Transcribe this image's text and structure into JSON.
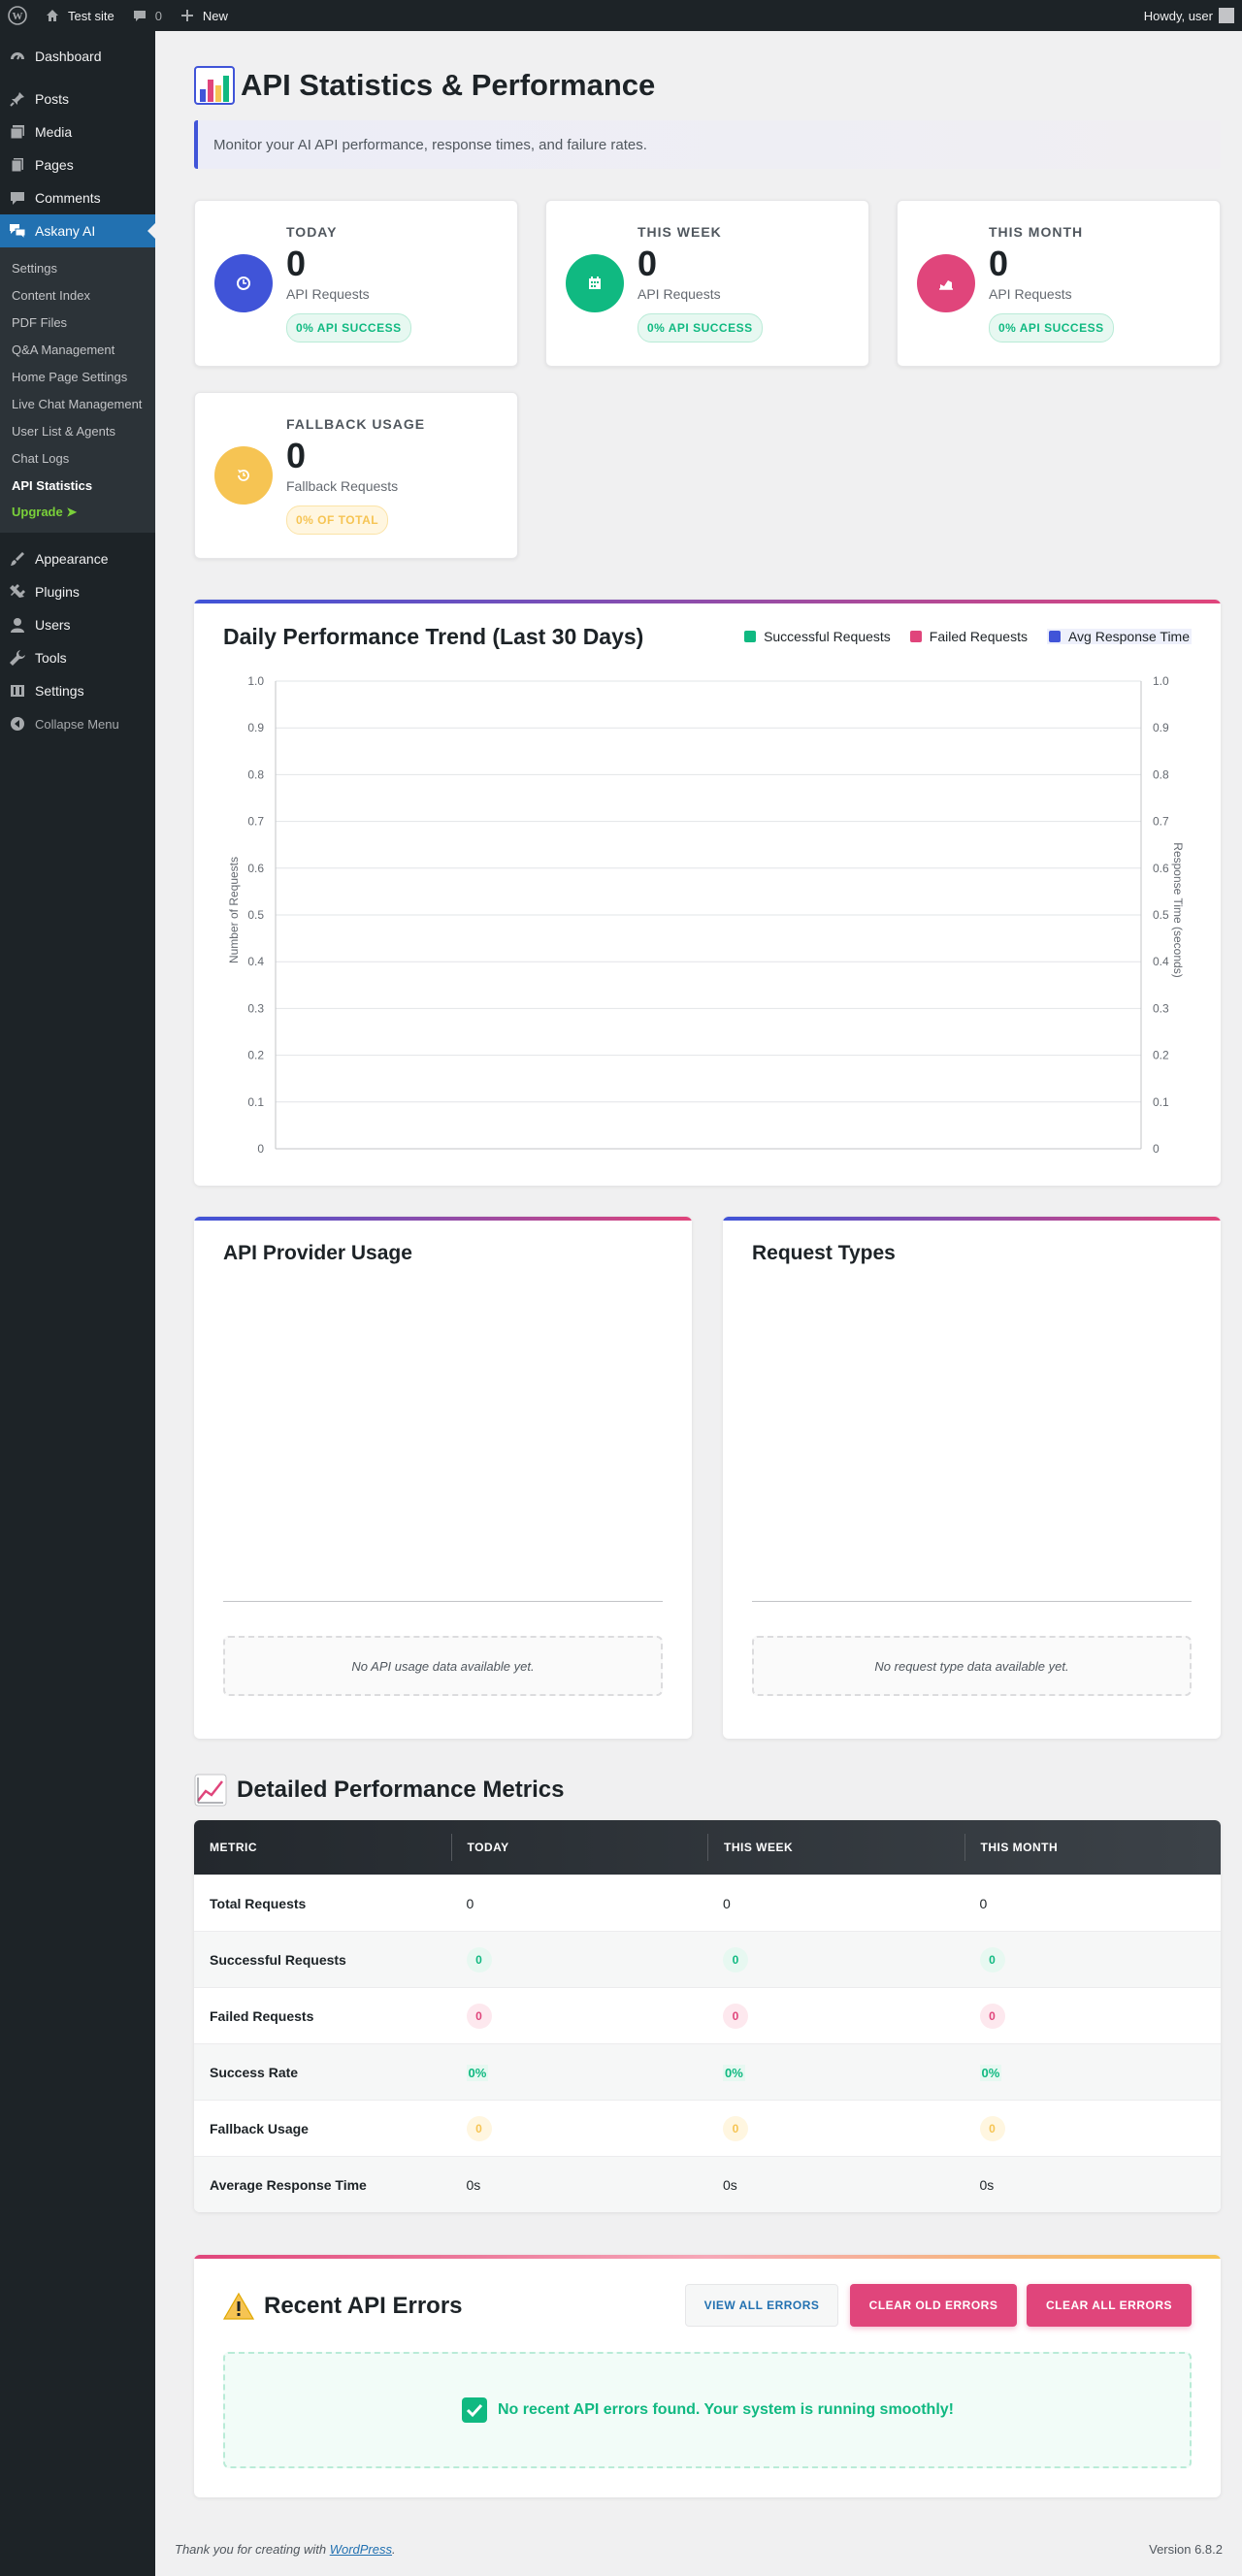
{
  "adminbar": {
    "site_name": "Test site",
    "comments_count": "0",
    "new_label": "New",
    "greeting": "Howdy, user"
  },
  "sidebar": {
    "items": [
      {
        "label": "Dashboard",
        "icon": "dashboard-icon"
      },
      {
        "label": "Posts",
        "icon": "pin-icon"
      },
      {
        "label": "Media",
        "icon": "media-icon"
      },
      {
        "label": "Pages",
        "icon": "pages-icon"
      },
      {
        "label": "Comments",
        "icon": "comment-icon"
      },
      {
        "label": "Askany AI",
        "icon": "chat-icon"
      }
    ],
    "submenu": [
      "Settings",
      "Content Index",
      "PDF Files",
      "Q&A Management",
      "Home Page Settings",
      "Live Chat Management",
      "User List & Agents",
      "Chat Logs",
      "API Statistics",
      "Upgrade ➤"
    ],
    "items2": [
      {
        "label": "Appearance",
        "icon": "brush-icon"
      },
      {
        "label": "Plugins",
        "icon": "plugin-icon"
      },
      {
        "label": "Users",
        "icon": "user-icon"
      },
      {
        "label": "Tools",
        "icon": "wrench-icon"
      },
      {
        "label": "Settings",
        "icon": "settings-icon"
      }
    ],
    "collapse": "Collapse Menu"
  },
  "page": {
    "title": "API Statistics & Performance",
    "subtitle": "Monitor your AI API performance, response times, and failure rates."
  },
  "cards": [
    {
      "label": "TODAY",
      "value": "0",
      "desc": "API Requests",
      "badge": "0% API SUCCESS",
      "color": "#4054d8",
      "icon": "clock-icon"
    },
    {
      "label": "THIS WEEK",
      "value": "0",
      "desc": "API Requests",
      "badge": "0% API SUCCESS",
      "color": "#10b981",
      "icon": "calendar-icon"
    },
    {
      "label": "THIS MONTH",
      "value": "0",
      "desc": "API Requests",
      "badge": "0% API SUCCESS",
      "color": "#e0457b",
      "icon": "chart-area-icon"
    },
    {
      "label": "FALLBACK USAGE",
      "value": "0",
      "desc": "Fallback Requests",
      "badge": "0% OF TOTAL",
      "color": "#f6c453",
      "icon": "backup-icon"
    }
  ],
  "trend": {
    "title": "Daily Performance Trend (Last 30 Days)",
    "legend": [
      "Successful Requests",
      "Failed Requests",
      "Avg Response Time"
    ],
    "legend_colors": [
      "#10b981",
      "#e0457b",
      "#4054d8"
    ]
  },
  "chart_data": {
    "type": "line",
    "title": "Daily Performance Trend (Last 30 Days)",
    "xlabel": "",
    "ylabel": "Number of Requests",
    "y2label": "Response Time (seconds)",
    "ylim": [
      0,
      1.0
    ],
    "y2lim": [
      0,
      1.0
    ],
    "yticks": [
      "0",
      "0.1",
      "0.2",
      "0.3",
      "0.4",
      "0.5",
      "0.6",
      "0.7",
      "0.8",
      "0.9",
      "1.0"
    ],
    "x": [],
    "series": [
      {
        "name": "Successful Requests",
        "values": []
      },
      {
        "name": "Failed Requests",
        "values": []
      },
      {
        "name": "Avg Response Time",
        "values": []
      }
    ],
    "grid": true,
    "legend_position": "top-right"
  },
  "provider": {
    "title": "API Provider Usage",
    "empty": "No API usage data available yet."
  },
  "request_types": {
    "title": "Request Types",
    "empty": "No request type data available yet."
  },
  "metrics": {
    "title": "Detailed Performance Metrics",
    "headers": [
      "METRIC",
      "TODAY",
      "THIS WEEK",
      "THIS MONTH"
    ],
    "rows": [
      {
        "label": "Total Requests",
        "values": [
          "0",
          "0",
          "0"
        ]
      },
      {
        "label": "Successful Requests",
        "values": [
          "0",
          "0",
          "0"
        ]
      },
      {
        "label": "Failed Requests",
        "values": [
          "0",
          "0",
          "0"
        ]
      },
      {
        "label": "Success Rate",
        "values": [
          "0%",
          "0%",
          "0%"
        ]
      },
      {
        "label": "Fallback Usage",
        "values": [
          "0",
          "0",
          "0"
        ]
      },
      {
        "label": "Average Response Time",
        "values": [
          "0s",
          "0s",
          "0s"
        ]
      }
    ]
  },
  "errors": {
    "title": "Recent API Errors",
    "btn_view": "VIEW ALL ERRORS",
    "btn_clear_old": "CLEAR OLD ERRORS",
    "btn_clear_all": "CLEAR ALL ERRORS",
    "ok_message": "No recent API errors found. Your system is running smoothly!"
  },
  "footer": {
    "thanks_prefix": "Thank you for creating with",
    "thanks_link": "WordPress",
    "thanks_suffix": ".",
    "version": "Version 6.8.2"
  }
}
